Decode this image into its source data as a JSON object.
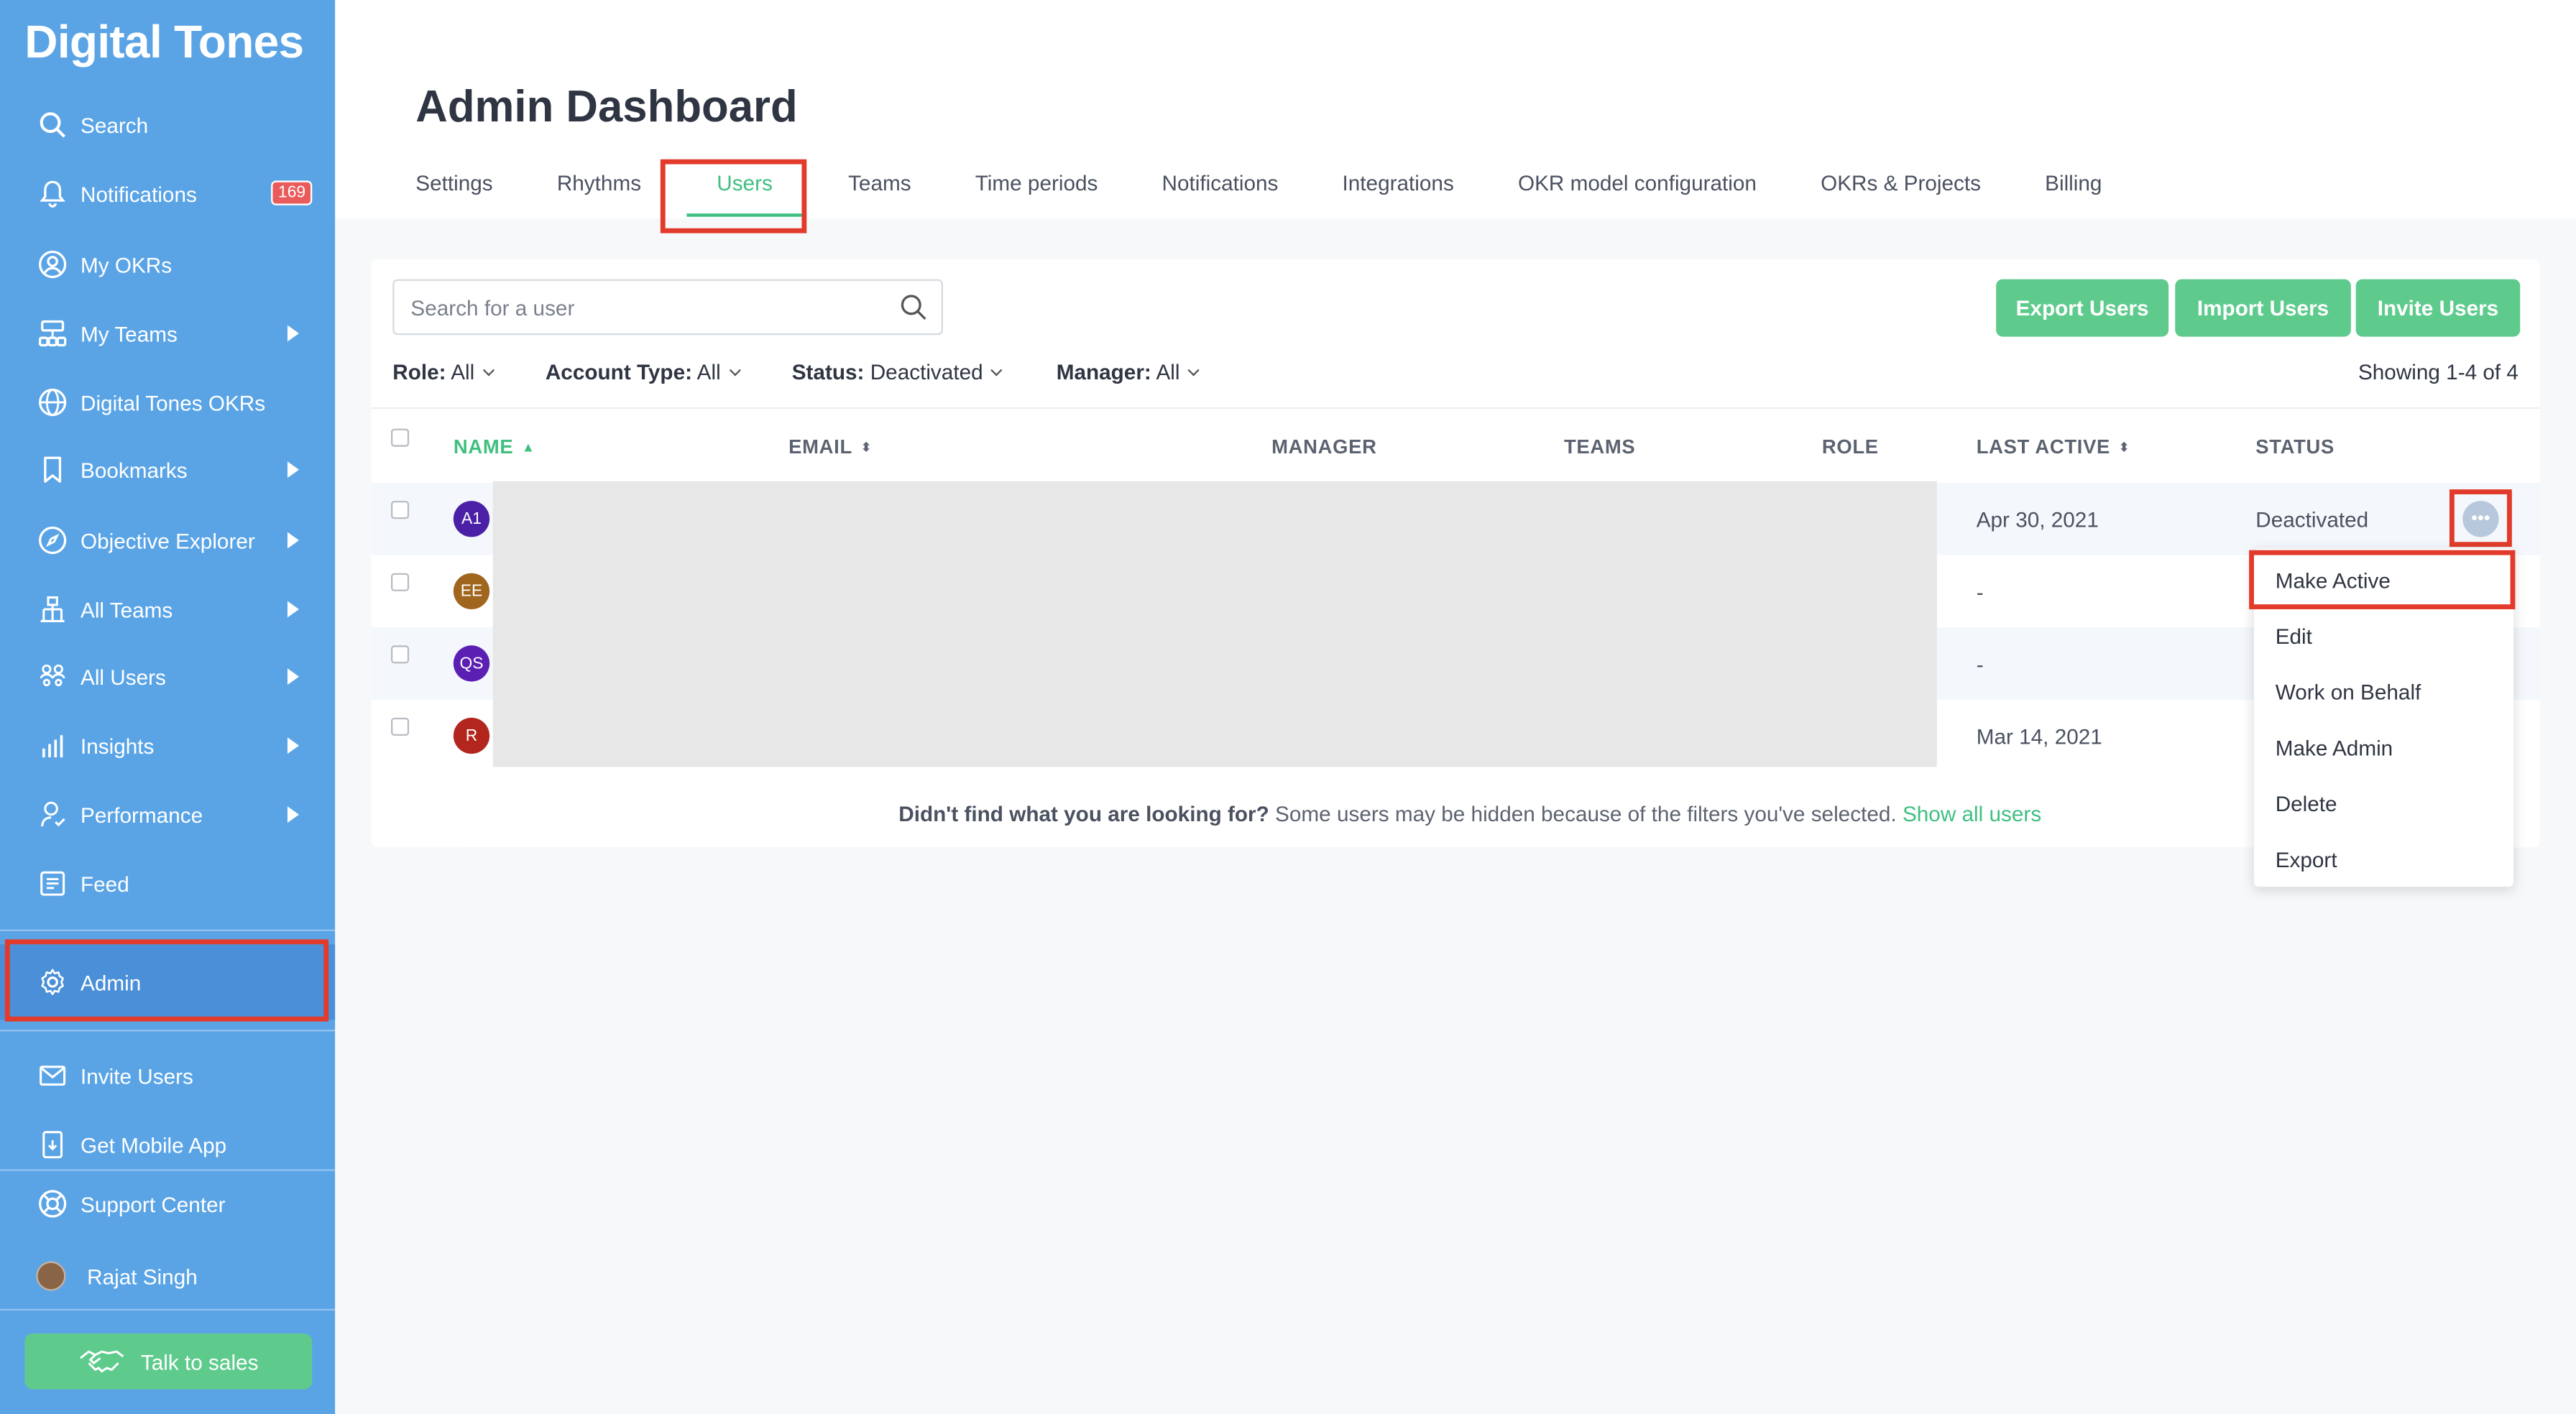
{
  "sidebar": {
    "brand": "Digital Tones",
    "items": [
      {
        "label": "Search"
      },
      {
        "label": "Notifications",
        "badge": "169"
      },
      {
        "label": "My OKRs"
      },
      {
        "label": "My Teams"
      },
      {
        "label": "Digital Tones OKRs"
      },
      {
        "label": "Bookmarks"
      },
      {
        "label": "Objective Explorer"
      },
      {
        "label": "All Teams"
      },
      {
        "label": "All Users"
      },
      {
        "label": "Insights"
      },
      {
        "label": "Performance"
      },
      {
        "label": "Feed"
      },
      {
        "label": "Admin"
      },
      {
        "label": "Invite Users"
      },
      {
        "label": "Get Mobile App"
      },
      {
        "label": "Support Center"
      },
      {
        "label": "Rajat Singh"
      }
    ],
    "talk_to_sales": "Talk to sales"
  },
  "header": {
    "title": "Admin Dashboard",
    "tabs": [
      {
        "label": "Settings"
      },
      {
        "label": "Rhythms"
      },
      {
        "label": "Users"
      },
      {
        "label": "Teams"
      },
      {
        "label": "Time periods"
      },
      {
        "label": "Notifications"
      },
      {
        "label": "Integrations"
      },
      {
        "label": "OKR model configuration"
      },
      {
        "label": "OKRs & Projects"
      },
      {
        "label": "Billing"
      }
    ]
  },
  "toolbar": {
    "search_placeholder": "Search for a user",
    "export": "Export Users",
    "import": "Import Users",
    "invite": "Invite Users"
  },
  "filters": {
    "role_label": "Role:",
    "role_value": "All",
    "account_label": "Account Type:",
    "account_value": "All",
    "status_label": "Status:",
    "status_value": "Deactivated",
    "manager_label": "Manager:",
    "manager_value": "All",
    "showing": "Showing 1-4 of 4"
  },
  "table": {
    "headers": [
      "NAME",
      "EMAIL",
      "MANAGER",
      "TEAMS",
      "ROLE",
      "LAST ACTIVE",
      "STATUS"
    ],
    "rows": [
      {
        "initials": "A1",
        "color": "#4b1fa6",
        "last_active": "Apr 30, 2021",
        "status": "Deactivated"
      },
      {
        "initials": "EE",
        "color": "#a0661e",
        "last_active": "-",
        "status": ""
      },
      {
        "initials": "QS",
        "color": "#5b1fb3",
        "last_active": "-",
        "status": ""
      },
      {
        "initials": "R",
        "color": "#b3261e",
        "last_active": "Mar 14, 2021",
        "status": ""
      }
    ]
  },
  "footer": {
    "bold": "Didn't find what you are looking for?",
    "text": "Some users may be hidden because of the filters you've selected.",
    "link": "Show all users"
  },
  "menu": {
    "items": [
      "Make Active",
      "Edit",
      "Work on Behalf",
      "Make Admin",
      "Delete",
      "Export"
    ]
  },
  "colors": {
    "sidebar": "#5aa4e6",
    "accent": "#3fbf80",
    "highlight": "#e23b2b"
  }
}
